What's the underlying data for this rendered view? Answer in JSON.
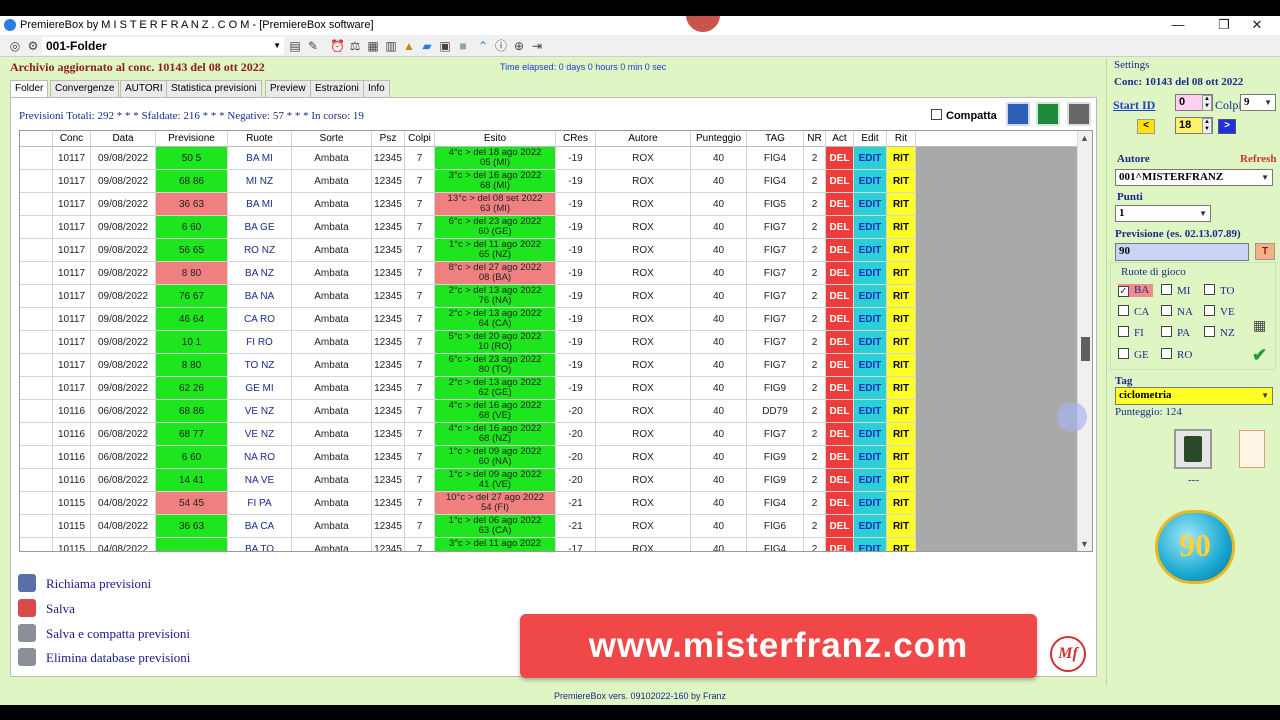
{
  "window": {
    "title": "PremiereBox by M I S T E R F R A N Z . C O M - [PremiereBox  software]",
    "controls": [
      "—",
      "❐",
      "✕"
    ]
  },
  "toolbar": {
    "folder": "001-Folder"
  },
  "header": {
    "archivio": "Archivio aggiornato al conc. 10143 del 08 ott 2022",
    "elapsed": "Time elapsed: 0 days 0 hours 0 min 0 sec"
  },
  "tabs": [
    "Folder",
    "Convergenze",
    "AUTORI",
    "Statistica previsioni",
    "Preview",
    "Estrazioni",
    "Info"
  ],
  "summary": {
    "totali": "Previsioni Totali: 292 * * * Sfaldate: 216 * * * Negative: 57 * * * In corso: 19",
    "compatta": "Compatta"
  },
  "grid": {
    "columns": [
      "",
      "Conc",
      "Data",
      "Previsione",
      "Ruote",
      "Sorte",
      "Psz",
      "Colpi",
      "Esito",
      "CRes",
      "Autore",
      "Punteggio",
      "TAG",
      "NR",
      "Act",
      "Edit",
      "Rit"
    ],
    "rows": [
      {
        "conc": "10117",
        "data": "09/08/2022",
        "prev": "50 5",
        "pc": "g",
        "ruote": "BA MI",
        "sorte": "Ambata",
        "psz": "12345",
        "colpi": "7",
        "e1": "4°c > del 18 ago 2022",
        "e2": "05 (MI)",
        "ec": "g",
        "cres": "-19",
        "autore": "ROX",
        "punt": "40",
        "tag": "FIG4",
        "nr": "2"
      },
      {
        "conc": "10117",
        "data": "09/08/2022",
        "prev": "68 86",
        "pc": "g",
        "ruote": "MI NZ",
        "sorte": "Ambata",
        "psz": "12345",
        "colpi": "7",
        "e1": "3°c > del 16 ago 2022",
        "e2": "68 (MI)",
        "ec": "g",
        "cres": "-19",
        "autore": "ROX",
        "punt": "40",
        "tag": "FIG4",
        "nr": "2"
      },
      {
        "conc": "10117",
        "data": "09/08/2022",
        "prev": "36 63",
        "pc": "r",
        "ruote": "BA MI",
        "sorte": "Ambata",
        "psz": "12345",
        "colpi": "7",
        "e1": "13°c > del 08 set 2022",
        "e2": "63 (MI)",
        "ec": "r",
        "cres": "-19",
        "autore": "ROX",
        "punt": "40",
        "tag": "FIG5",
        "nr": "2"
      },
      {
        "conc": "10117",
        "data": "09/08/2022",
        "prev": "6 60",
        "pc": "g",
        "ruote": "BA GE",
        "sorte": "Ambata",
        "psz": "12345",
        "colpi": "7",
        "e1": "6°c > del 23 ago 2022",
        "e2": "60 (GE)",
        "ec": "g",
        "cres": "-19",
        "autore": "ROX",
        "punt": "40",
        "tag": "FIG7",
        "nr": "2"
      },
      {
        "conc": "10117",
        "data": "09/08/2022",
        "prev": "56 65",
        "pc": "g",
        "ruote": "RO NZ",
        "sorte": "Ambata",
        "psz": "12345",
        "colpi": "7",
        "e1": "1°c > del 11 ago 2022",
        "e2": "65 (NZ)",
        "ec": "g",
        "cres": "-19",
        "autore": "ROX",
        "punt": "40",
        "tag": "FIG7",
        "nr": "2"
      },
      {
        "conc": "10117",
        "data": "09/08/2022",
        "prev": "8 80",
        "pc": "r",
        "ruote": "BA NZ",
        "sorte": "Ambata",
        "psz": "12345",
        "colpi": "7",
        "e1": "8°c > del 27 ago 2022",
        "e2": "08 (BA)",
        "ec": "r",
        "cres": "-19",
        "autore": "ROX",
        "punt": "40",
        "tag": "FIG7",
        "nr": "2"
      },
      {
        "conc": "10117",
        "data": "09/08/2022",
        "prev": "76 67",
        "pc": "g",
        "ruote": "BA NA",
        "sorte": "Ambata",
        "psz": "12345",
        "colpi": "7",
        "e1": "2°c > del 13 ago 2022",
        "e2": "76 (NA)",
        "ec": "g",
        "cres": "-19",
        "autore": "ROX",
        "punt": "40",
        "tag": "FIG7",
        "nr": "2"
      },
      {
        "conc": "10117",
        "data": "09/08/2022",
        "prev": "46 64",
        "pc": "g",
        "ruote": "CA RO",
        "sorte": "Ambata",
        "psz": "12345",
        "colpi": "7",
        "e1": "2°c > del 13 ago 2022",
        "e2": "64 (CA)",
        "ec": "g",
        "cres": "-19",
        "autore": "ROX",
        "punt": "40",
        "tag": "FIG7",
        "nr": "2"
      },
      {
        "conc": "10117",
        "data": "09/08/2022",
        "prev": "10 1",
        "pc": "g",
        "ruote": "FI RO",
        "sorte": "Ambata",
        "psz": "12345",
        "colpi": "7",
        "e1": "5°c > del 20 ago 2022",
        "e2": "10 (RO)",
        "ec": "g",
        "cres": "-19",
        "autore": "ROX",
        "punt": "40",
        "tag": "FIG7",
        "nr": "2"
      },
      {
        "conc": "10117",
        "data": "09/08/2022",
        "prev": "8 80",
        "pc": "g",
        "ruote": "TO NZ",
        "sorte": "Ambata",
        "psz": "12345",
        "colpi": "7",
        "e1": "6°c > del 23 ago 2022",
        "e2": "80 (TO)",
        "ec": "g",
        "cres": "-19",
        "autore": "ROX",
        "punt": "40",
        "tag": "FIG7",
        "nr": "2"
      },
      {
        "conc": "10117",
        "data": "09/08/2022",
        "prev": "62 26",
        "pc": "g",
        "ruote": "GE MI",
        "sorte": "Ambata",
        "psz": "12345",
        "colpi": "7",
        "e1": "2°c > del 13 ago 2022",
        "e2": "62 (GE)",
        "ec": "g",
        "cres": "-19",
        "autore": "ROX",
        "punt": "40",
        "tag": "FIG9",
        "nr": "2"
      },
      {
        "conc": "10116",
        "data": "06/08/2022",
        "prev": "68 86",
        "pc": "g",
        "ruote": "VE NZ",
        "sorte": "Ambata",
        "psz": "12345",
        "colpi": "7",
        "e1": "4°c > del 16 ago 2022",
        "e2": "68 (VE)",
        "ec": "g",
        "cres": "-20",
        "autore": "ROX",
        "punt": "40",
        "tag": "DD79",
        "nr": "2"
      },
      {
        "conc": "10116",
        "data": "06/08/2022",
        "prev": "68 77",
        "pc": "g",
        "ruote": "VE NZ",
        "sorte": "Ambata",
        "psz": "12345",
        "colpi": "7",
        "e1": "4°c > del 16 ago 2022",
        "e2": "68 (NZ)",
        "ec": "g",
        "cres": "-20",
        "autore": "ROX",
        "punt": "40",
        "tag": "FIG7",
        "nr": "2"
      },
      {
        "conc": "10116",
        "data": "06/08/2022",
        "prev": "6 60",
        "pc": "g",
        "ruote": "NA RO",
        "sorte": "Ambata",
        "psz": "12345",
        "colpi": "7",
        "e1": "1°c > del 09 ago 2022",
        "e2": "60 (NA)",
        "ec": "g",
        "cres": "-20",
        "autore": "ROX",
        "punt": "40",
        "tag": "FIG9",
        "nr": "2"
      },
      {
        "conc": "10116",
        "data": "06/08/2022",
        "prev": "14 41",
        "pc": "g",
        "ruote": "NA VE",
        "sorte": "Ambata",
        "psz": "12345",
        "colpi": "7",
        "e1": "1°c > del 09 ago 2022",
        "e2": "41 (VE)",
        "ec": "g",
        "cres": "-20",
        "autore": "ROX",
        "punt": "40",
        "tag": "FIG9",
        "nr": "2"
      },
      {
        "conc": "10115",
        "data": "04/08/2022",
        "prev": "54 45",
        "pc": "r",
        "ruote": "FI PA",
        "sorte": "Ambata",
        "psz": "12345",
        "colpi": "7",
        "e1": "10°c > del 27 ago 2022",
        "e2": "54 (FI)",
        "ec": "r",
        "cres": "-21",
        "autore": "ROX",
        "punt": "40",
        "tag": "FIG4",
        "nr": "2"
      },
      {
        "conc": "10115",
        "data": "04/08/2022",
        "prev": "36 63",
        "pc": "g",
        "ruote": "BA CA",
        "sorte": "Ambata",
        "psz": "12345",
        "colpi": "7",
        "e1": "1°c > del 06 ago 2022",
        "e2": "63 (CA)",
        "ec": "g",
        "cres": "-21",
        "autore": "ROX",
        "punt": "40",
        "tag": "FIG6",
        "nr": "2"
      },
      {
        "conc": "10115",
        "data": "04/08/2022",
        "prev": "",
        "pc": "g",
        "ruote": "BA TO",
        "sorte": "Ambata",
        "psz": "12345",
        "colpi": "7",
        "e1": "3°c > del 11 ago 2022",
        "e2": "",
        "ec": "g",
        "cres": "-17",
        "autore": "ROX",
        "punt": "40",
        "tag": "FIG4",
        "nr": "2"
      }
    ],
    "act": "DEL",
    "edit": "EDIT",
    "rit": "RIT"
  },
  "actions": [
    "Richiama previsioni",
    "Salva",
    "Salva e compatta previsioni",
    "Elimina database previsioni"
  ],
  "banner": "www.misterfranz.com",
  "banner_logo": "Mf",
  "status": "PremiereBox vers. 09102022-160 by Franz",
  "settings": {
    "title": "Settings",
    "conc": "Conc: 10143 del 08 ott 2022",
    "start_id_label": "Start ID",
    "start_id_value": "0",
    "colpi_label": "Colpi",
    "colpi_value": "9",
    "nav_prev": "<",
    "nav_value": "18",
    "nav_next": ">",
    "autore_label": "Autore",
    "refresh": "Refresh",
    "autore_value": "001^MISTERFRANZ",
    "punti_label": "Punti",
    "punti_value": "1",
    "previsione_label": "Previsione (es. 02.13.07.89)",
    "previsione_value": "90",
    "t_button": "T",
    "ruote_label": "Ruote di gioco",
    "ruote": [
      {
        "name": "BA",
        "checked": true
      },
      {
        "name": "MI",
        "checked": false
      },
      {
        "name": "TO",
        "checked": false
      },
      {
        "name": "CA",
        "checked": false
      },
      {
        "name": "NA",
        "checked": false
      },
      {
        "name": "VE",
        "checked": false
      },
      {
        "name": "FI",
        "checked": false
      },
      {
        "name": "PA",
        "checked": false
      },
      {
        "name": "NZ",
        "checked": false
      },
      {
        "name": "GE",
        "checked": false
      },
      {
        "name": "RO",
        "checked": false
      }
    ],
    "tag_label": "Tag",
    "tag_value": "ciclometria",
    "punteggio": "Punteggio: 124",
    "dots": "---",
    "badge": "90"
  },
  "colors": {
    "green": "#1ee61e",
    "red": "#f08080",
    "del": "#ee3b3b",
    "edit": "#2ccfd6",
    "rit": "#ffff26"
  }
}
